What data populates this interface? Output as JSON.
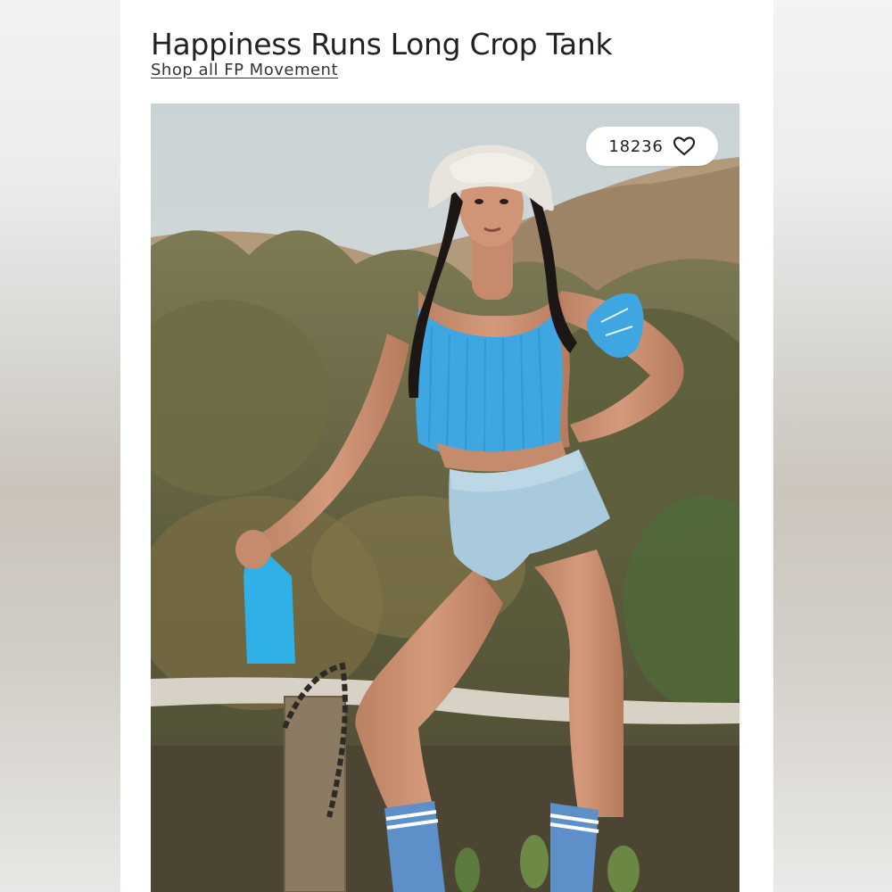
{
  "product": {
    "title": "Happiness Runs Long Crop Tank",
    "shop_link": "Shop all FP Movement"
  },
  "likes": {
    "count": "18236",
    "icon": "heart-outline-icon"
  },
  "colors": {
    "tank": "#3ea6e0",
    "shorts": "#a9c9dc",
    "bottle": "#2fb0e6",
    "text": "#222222"
  }
}
